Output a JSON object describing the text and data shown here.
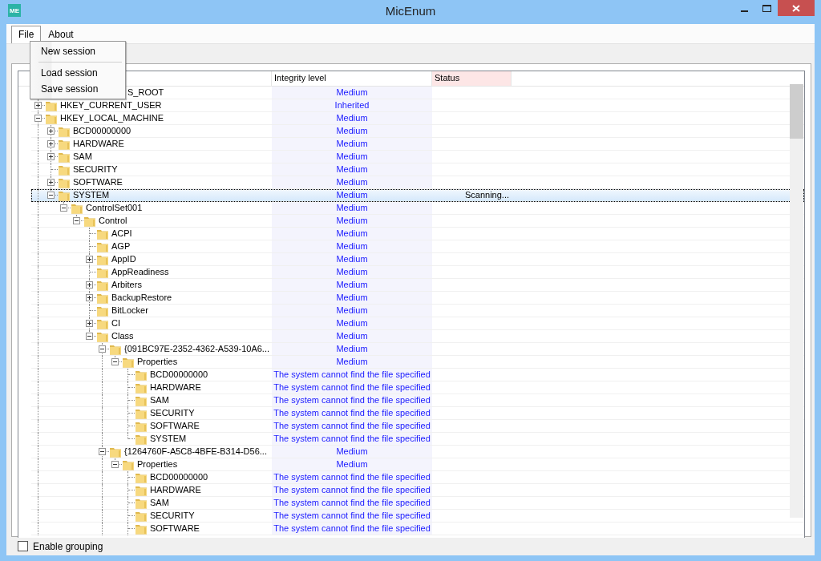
{
  "window": {
    "title": "MicEnum",
    "logo": "ME"
  },
  "menus": [
    {
      "label": "File",
      "selected": true,
      "items": [
        {
          "kind": "item",
          "label": "New session"
        },
        {
          "kind": "separator"
        },
        {
          "kind": "item",
          "label": "Load session"
        },
        {
          "kind": "item",
          "label": "Save session"
        }
      ]
    },
    {
      "label": "About",
      "selected": false
    }
  ],
  "columns": [
    {
      "label": "Integrity level"
    },
    {
      "label": "Status"
    }
  ],
  "tree": [
    {
      "name": "S_ROOT",
      "hidden_left": true,
      "integrity": "Medium",
      "selected": false
    },
    {
      "name": "HKEY_CURRENT_USER",
      "integrity": "Inherited",
      "selected": false,
      "expanded": false
    },
    {
      "name": "HKEY_LOCAL_MACHINE",
      "integrity": "Medium",
      "selected": false,
      "expanded": true,
      "more_below": true,
      "children": [
        {
          "name": "BCD00000000",
          "integrity": "Medium",
          "selected": false,
          "expanded": false
        },
        {
          "name": "HARDWARE",
          "integrity": "Medium",
          "selected": false,
          "expanded": false
        },
        {
          "name": "SAM",
          "integrity": "Medium",
          "selected": false,
          "expanded": false
        },
        {
          "name": "SECURITY",
          "integrity": "Medium",
          "selected": false
        },
        {
          "name": "SOFTWARE",
          "integrity": "Medium",
          "selected": false,
          "expanded": false
        },
        {
          "name": "SYSTEM",
          "integrity": "Medium",
          "status": "Scanning...",
          "selected": true,
          "expanded": true,
          "children": [
            {
              "name": "ControlSet001",
              "integrity": "Medium",
              "selected": false,
              "expanded": true,
              "children": [
                {
                  "name": "Control",
                  "integrity": "Medium",
                  "selected": false,
                  "expanded": true,
                  "children": [
                    {
                      "name": "ACPI",
                      "integrity": "Medium",
                      "selected": false
                    },
                    {
                      "name": "AGP",
                      "integrity": "Medium",
                      "selected": false
                    },
                    {
                      "name": "AppID",
                      "integrity": "Medium",
                      "selected": false,
                      "expanded": false
                    },
                    {
                      "name": "AppReadiness",
                      "integrity": "Medium",
                      "selected": false
                    },
                    {
                      "name": "Arbiters",
                      "integrity": "Medium",
                      "selected": false,
                      "expanded": false
                    },
                    {
                      "name": "BackupRestore",
                      "integrity": "Medium",
                      "selected": false,
                      "expanded": false
                    },
                    {
                      "name": "BitLocker",
                      "integrity": "Medium",
                      "selected": false
                    },
                    {
                      "name": "CI",
                      "integrity": "Medium",
                      "selected": false,
                      "expanded": false
                    },
                    {
                      "name": "Class",
                      "integrity": "Medium",
                      "selected": false,
                      "expanded": true,
                      "children": [
                        {
                          "name": "{091BC97E-2352-4362-A539-10A6...",
                          "integrity": "Medium",
                          "selected": false,
                          "expanded": true,
                          "children": [
                            {
                              "name": "Properties",
                              "integrity": "Medium",
                              "selected": false,
                              "expanded": true,
                              "children": [
                                {
                                  "name": "BCD00000000",
                                  "integrity": "The system cannot find the file specified",
                                  "selected": false
                                },
                                {
                                  "name": "HARDWARE",
                                  "integrity": "The system cannot find the file specified",
                                  "selected": false
                                },
                                {
                                  "name": "SAM",
                                  "integrity": "The system cannot find the file specified",
                                  "selected": false
                                },
                                {
                                  "name": "SECURITY",
                                  "integrity": "The system cannot find the file specified",
                                  "selected": false
                                },
                                {
                                  "name": "SOFTWARE",
                                  "integrity": "The system cannot find the file specified",
                                  "selected": false
                                },
                                {
                                  "name": "SYSTEM",
                                  "integrity": "The system cannot find the file specified",
                                  "selected": false
                                }
                              ]
                            }
                          ]
                        },
                        {
                          "name": "{1264760F-A5C8-4BFE-B314-D56...",
                          "integrity": "Medium",
                          "selected": false,
                          "expanded": true,
                          "more_below": true,
                          "children": [
                            {
                              "name": "Properties",
                              "integrity": "Medium",
                              "selected": false,
                              "expanded": true,
                              "children": [
                                {
                                  "name": "BCD00000000",
                                  "integrity": "The system cannot find the file specified",
                                  "selected": false
                                },
                                {
                                  "name": "HARDWARE",
                                  "integrity": "The system cannot find the file specified",
                                  "selected": false
                                },
                                {
                                  "name": "SAM",
                                  "integrity": "The system cannot find the file specified",
                                  "selected": false
                                },
                                {
                                  "name": "SECURITY",
                                  "integrity": "The system cannot find the file specified",
                                  "selected": false
                                },
                                {
                                  "name": "SOFTWARE",
                                  "integrity": "The system cannot find the file specified",
                                  "selected": false,
                                  "more_below": true
                                }
                              ]
                            }
                          ]
                        }
                      ]
                    }
                  ]
                }
              ]
            }
          ]
        }
      ]
    }
  ],
  "grouping": {
    "label": "Enable grouping",
    "checked": false
  }
}
